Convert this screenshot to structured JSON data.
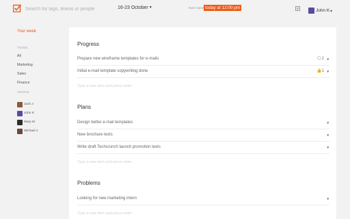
{
  "header": {
    "search_placeholder": "Search for tags, teams or people",
    "week_label": "16-23 October",
    "report_prefix": "Next report will be sent",
    "report_time": "today at 12:00 pm",
    "user_name": "John K"
  },
  "sidebar": {
    "active_item": "Your week",
    "teams_heading": "TEAMS",
    "teams": [
      "All",
      "Marketing",
      "Sales",
      "Finance"
    ],
    "people_heading": "PEOPLE",
    "people": [
      {
        "name": "Jack J",
        "color": "#8a5a3c"
      },
      {
        "name": "John K",
        "color": "#5b4aa0"
      },
      {
        "name": "Mary M",
        "color": "#2c2c2c"
      },
      {
        "name": "Michael J",
        "color": "#6a4a3a"
      }
    ]
  },
  "sections": {
    "progress": {
      "title": "Progress",
      "items": [
        {
          "text": "Prepare new wireframe templates for e-mails",
          "meta_icon": "comment-icon",
          "meta_count": "2"
        },
        {
          "text": "Initial e-mail template copywriting done",
          "meta_icon": "thumbs-up-icon",
          "meta_count": "1"
        }
      ],
      "new_placeholder": "Type a new item and press enter"
    },
    "plans": {
      "title": "Plans",
      "items": [
        {
          "text": "Design better e-mail templates"
        },
        {
          "text": "New brochure texts"
        },
        {
          "text": "Write draft Techcrunch launch promotion texts"
        }
      ],
      "new_placeholder": "Type a new item and press enter"
    },
    "problems": {
      "title": "Problems",
      "items": [
        {
          "text": "Looking for new marketing intern"
        }
      ],
      "new_placeholder": "Type a new item and press enter"
    }
  },
  "colors": {
    "accent": "#ee5a16",
    "background": "#f2f2f2",
    "panel": "#ffffff"
  }
}
